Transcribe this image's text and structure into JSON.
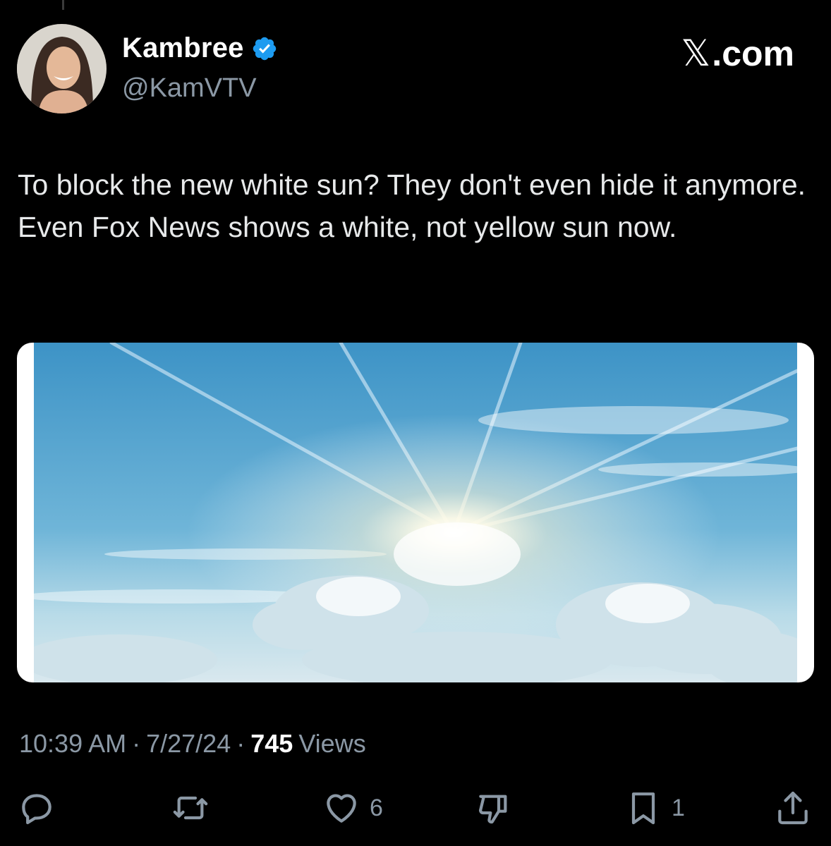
{
  "author": {
    "display_name": "Kambree",
    "handle": "@KamVTV",
    "verified_icon": "verified-badge-icon",
    "avatar_icon": "avatar-photo"
  },
  "source": {
    "label": ".com",
    "logo_icon": "x-logo-icon"
  },
  "tweet": {
    "text": "To block the new white sun? They don't even hide it anymore. Even Fox News shows a white, not yellow sun now."
  },
  "media": {
    "description_icon": "sun-sky-photo"
  },
  "meta": {
    "time": "10:39 AM",
    "sep1": "·",
    "date": "7/27/24",
    "sep2": "·",
    "views_count": "745",
    "views_label": "Views"
  },
  "actions": {
    "reply": {
      "icon": "reply-icon",
      "count": ""
    },
    "repost": {
      "icon": "repost-icon",
      "count": ""
    },
    "like": {
      "icon": "heart-icon",
      "count": "6"
    },
    "dislike": {
      "icon": "dislike-icon",
      "count": ""
    },
    "bookmark": {
      "icon": "bookmark-icon",
      "count": "1"
    },
    "share": {
      "icon": "share-icon",
      "count": ""
    }
  },
  "colors": {
    "background": "#000000",
    "text": "#e7e9ea",
    "muted": "#8b98a5",
    "verified": "#1d9bf0"
  }
}
